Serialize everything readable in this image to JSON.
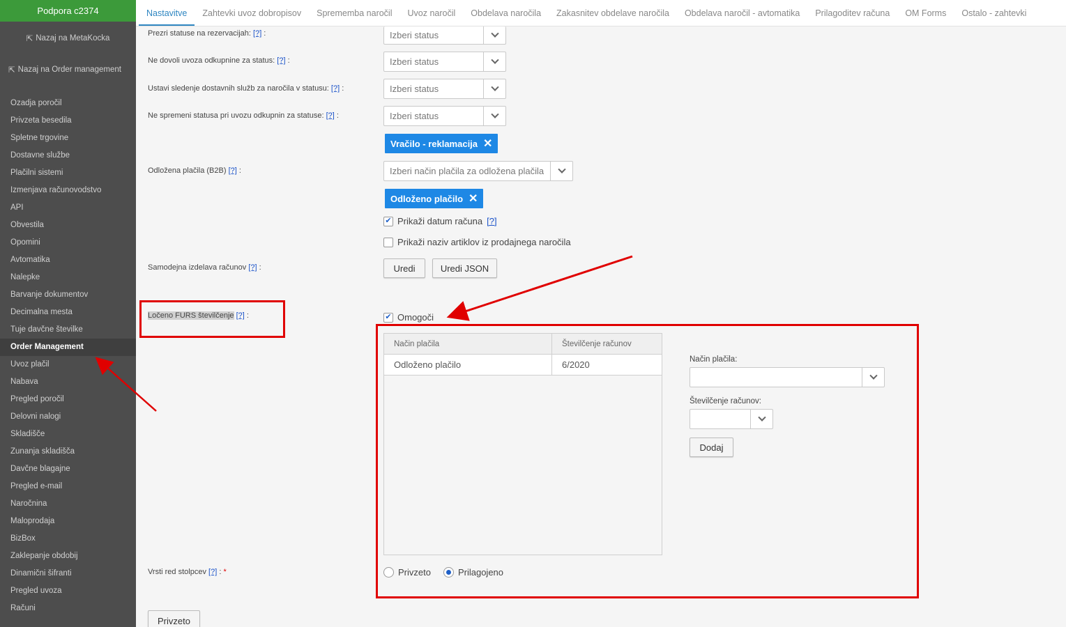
{
  "sidebar": {
    "brand": "Podpora c2374",
    "back_meta": "Nazaj na MetaKocka",
    "back_order": "Nazaj na Order management",
    "items": [
      "Ozadja poročil",
      "Privzeta besedila",
      "Spletne trgovine",
      "Dostavne službe",
      "Plačilni sistemi",
      "Izmenjava računovodstvo",
      "API",
      "Obvestila",
      "Opomini",
      "Avtomatika",
      "Nalepke",
      "Barvanje dokumentov",
      "Decimalna mesta",
      "Tuje davčne številke",
      "Order Management",
      "Uvoz plačil",
      "Nabava",
      "Pregled poročil",
      "Delovni nalogi",
      "Skladišče",
      "Zunanja skladišča",
      "Davčne blagajne",
      "Pregled e-mail",
      "Naročnina",
      "Maloprodaja",
      "BizBox",
      "Zaklepanje obdobij",
      "Dinamični šifranti",
      "Pregled uvoza",
      "Računi"
    ],
    "active_index": 14
  },
  "tabs": [
    "Nastavitve",
    "Zahtevki uvoz dobropisov",
    "Sprememba naročil",
    "Uvoz naročil",
    "Obdelava naročila",
    "Zakasnitev obdelave naročila",
    "Obdelava naročil - avtomatika",
    "Prilagoditev računa",
    "OM Forms",
    "Ostalo - zahtevki"
  ],
  "form": {
    "help": "[?]",
    "label_rezervacije": "Prezri statuse na rezervacijah:",
    "label_odkupnine": "Ne dovoli uvoza odkupnine za status:",
    "label_sledenje": "Ustavi sledenje dostavnih služb za naročila v statusu:",
    "label_ne_spremeni": "Ne spremeni statusa pri uvozu odkupnin za statuse:",
    "select_status": "Izberi status",
    "chip_vracilo": "Vračilo - reklamacija",
    "label_odlozena": "Odložena plačila (B2B)",
    "select_odlozena": "Izberi način plačila za odložena plačila",
    "chip_odlozeno": "Odloženo plačilo",
    "check_datum": "Prikaži datum računa",
    "check_naziv": "Prikaži naziv artiklov iz prodajnega naročila",
    "label_samodejna": "Samodejna izdelava računov",
    "btn_uredi": "Uredi",
    "btn_uredi_json": "Uredi JSON",
    "label_loceno": "Ločeno FURS številčenje",
    "check_omogoci": "Omogoči",
    "table_head_1": "Način plačila",
    "table_head_2": "Številčenje računov",
    "table_row_1": "Odloženo plačilo",
    "table_row_2": "6/2020",
    "label_nacin": "Način plačila:",
    "label_stevilcenje": "Številčenje računov:",
    "btn_dodaj": "Dodaj",
    "label_vrsti": "Vrsti red stolpcev",
    "radio_privzeto": "Privzeto",
    "radio_prilagojeno": "Prilagojeno",
    "btn_privzeto": "Privzeto"
  },
  "colors": {
    "brand": "#3c9a3a",
    "sidebar": "#4d4d4d",
    "chip": "#1e88e5",
    "annotation": "#e00000"
  }
}
